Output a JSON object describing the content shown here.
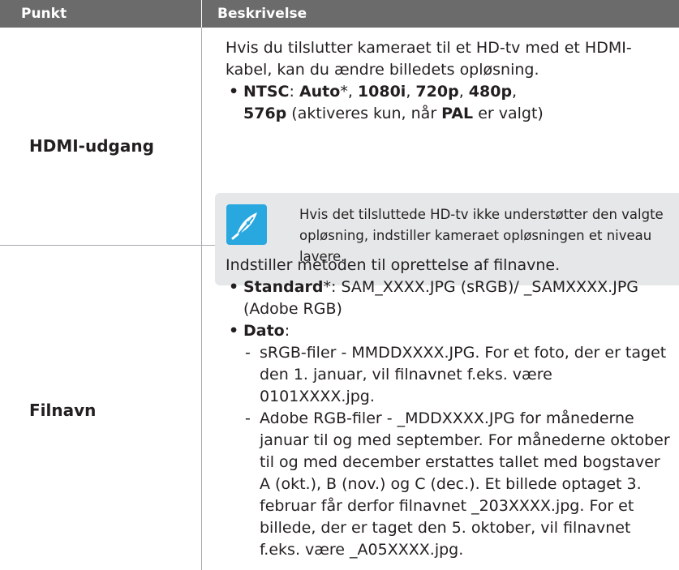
{
  "header": {
    "col_item": "Punkt",
    "col_desc": "Beskrivelse"
  },
  "rows": [
    {
      "item": "HDMI-udgang",
      "intro": "Hvis du tilslutter kameraet til et HD-tv med et HDMI-kabel, kan du ændre billedets opløsning.",
      "bullet": {
        "label": "NTSC",
        "colon": ": ",
        "auto": "Auto",
        "star": "*, ",
        "o1": "1080i",
        "c1": ", ",
        "o2": "720p",
        "c2": ", ",
        "o3": "480p",
        "c3": ",",
        "o4": "576p",
        "mid": " (aktiveres kun, når ",
        "pal": "PAL",
        "end": " er valgt)"
      },
      "note": {
        "icon": "note-pen-icon",
        "text": "Hvis det tilsluttede HD-tv ikke understøtter den valgte opløsning, indstiller kameraet opløsningen et niveau lavere."
      }
    },
    {
      "item": "Filnavn",
      "intro": "Indstiller metoden til oprettelse af filnavne.",
      "standard": {
        "label": "Standard",
        "rest": "*: SAM_XXXX.JPG (sRGB)/ _SAMXXXX.JPG (Adobe RGB)"
      },
      "dato": {
        "label": "Dato",
        "colon": ":"
      },
      "dashes": [
        "sRGB-filer - MMDDXXXX.JPG. For et foto, der er taget den 1. januar, vil filnavnet f.eks. være 0101XXXX.jpg.",
        "Adobe RGB-filer - _MDDXXXX.JPG for månederne januar til og med september. For månederne oktober til og med december erstattes tallet med bogstaver A (okt.), B (nov.) og C (dec.). Et billede optaget 3. februar får derfor filnavnet _203XXXX.jpg. For et billede, der er taget den 5. oktober, vil filnavnet f.eks. være _A05XXXX.jpg."
      ]
    }
  ],
  "colors": {
    "header_bg": "#6b6b6b",
    "note_bg": "#e6e7e8",
    "icon_blue": "#29a7df",
    "rule": "#a7a9ac"
  }
}
